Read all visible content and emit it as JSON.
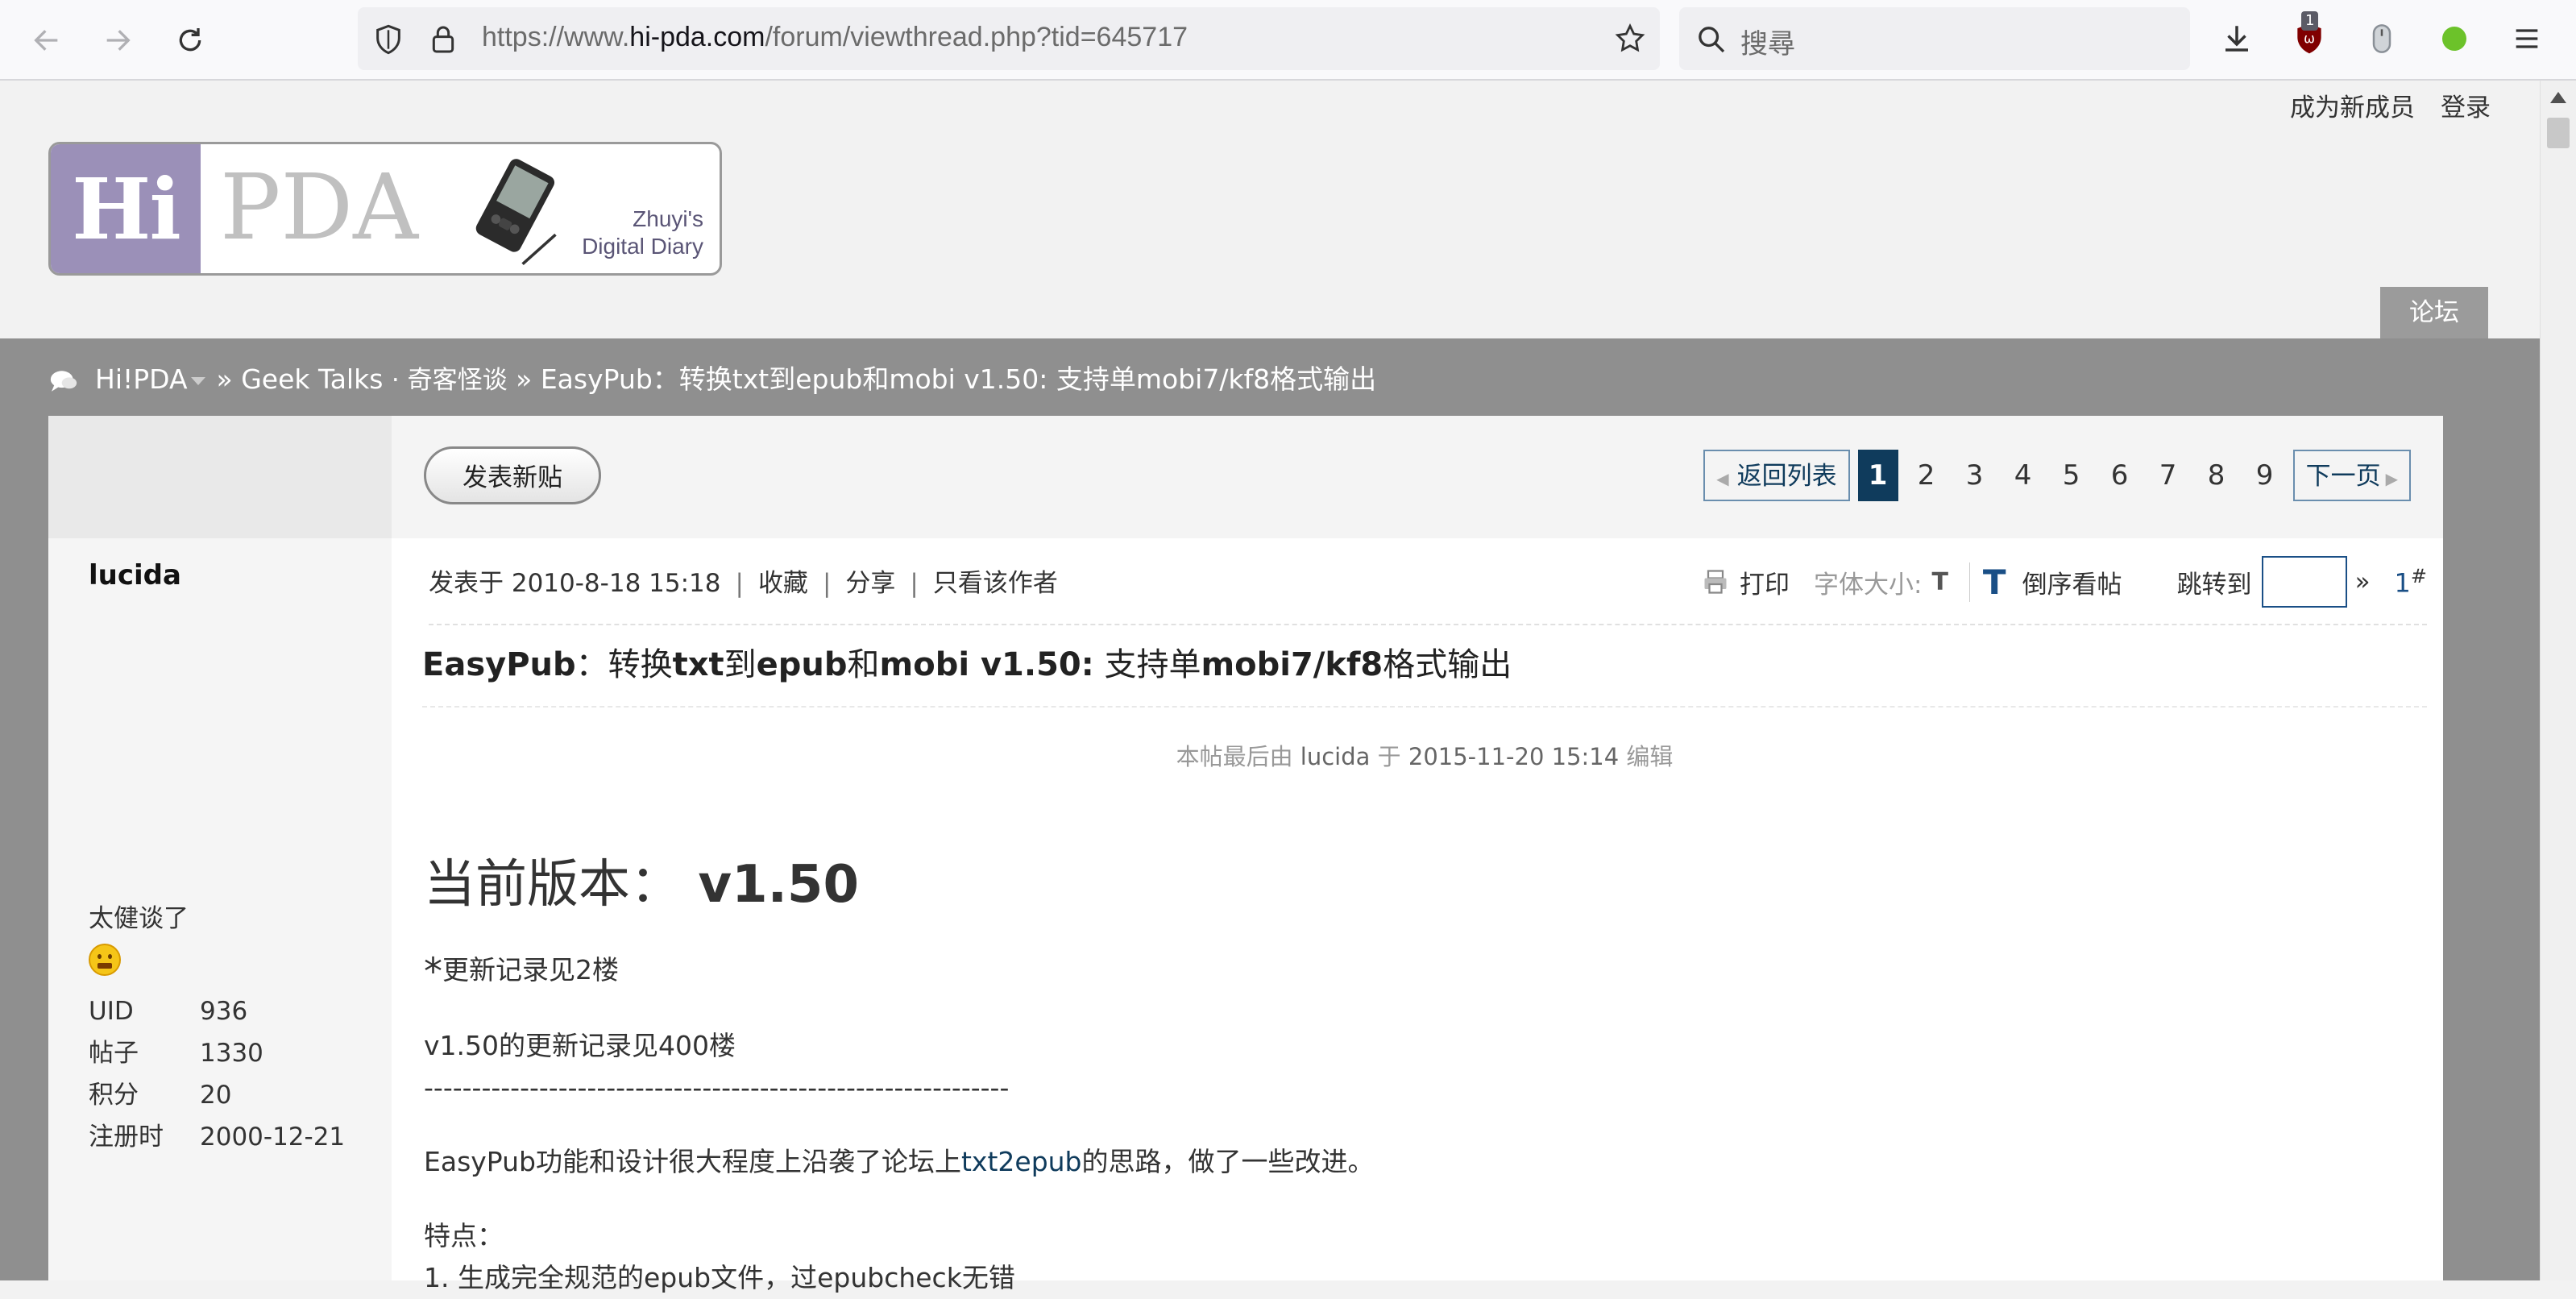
{
  "browser": {
    "url_prefix": "https://www.",
    "url_domain": "hi-pda.com",
    "url_path": "/forum/viewthread.php?tid=645717",
    "search_placeholder": "搜尋",
    "ublock_count": "1"
  },
  "top_links": [
    "成为新成员",
    "登录"
  ],
  "logo": {
    "hi": "Hi",
    "pda": "PDA",
    "tag_line1": "Zhuyi's",
    "tag_line2": "Digital Diary"
  },
  "forum_tab": "论坛",
  "breadcrumb": {
    "home": "Hi!PDA",
    "sep1": "»",
    "forum": "Geek Talks",
    "forum_sub": "· 奇客怪谈",
    "sep2": "»",
    "thread": "EasyPub：转换txt到epub和mobi v1.50: 支持单mobi7/kf8格式输出"
  },
  "toolbar": {
    "new_post": "发表新贴",
    "back_list": "返回列表",
    "pages": [
      "1",
      "2",
      "3",
      "4",
      "5",
      "6",
      "7",
      "8",
      "9"
    ],
    "current_page": "1",
    "next": "下一页"
  },
  "author": {
    "name": "lucida",
    "title": "太健谈了",
    "stats": [
      {
        "k": "UID",
        "v": "936"
      },
      {
        "k": "帖子",
        "v": "1330"
      },
      {
        "k": "积分",
        "v": "20"
      },
      {
        "k": "注册时",
        "v": "2000-12-21"
      }
    ]
  },
  "post_meta": {
    "posted_label": "发表于 2010-8-18 15:18",
    "fav": "收藏",
    "share": "分享",
    "only_author": "只看该作者",
    "print": "打印",
    "font_size": "字体大小:",
    "font_small": "T",
    "font_big": "T",
    "reverse": "倒序看帖",
    "jump": "跳转到",
    "jump_arrow": "»",
    "floor": "1",
    "floor_mark": "#"
  },
  "post": {
    "title_a": "EasyPub",
    "title_b": "：转换",
    "title_c": "txt",
    "title_d": "到",
    "title_e": "epub",
    "title_f": "和",
    "title_g": "mobi v1.50:",
    "title_h": " 支持单",
    "title_i": "mobi7/kf8",
    "title_j": "格式输出",
    "edit_pre": "本帖最后由",
    "edit_user": "lucida",
    "edit_mid": "于",
    "edit_time": "2015-11-20 15:14",
    "edit_post": "编辑",
    "heading_a": "当前版本：",
    "heading_b": "v1.50",
    "star": "*",
    "note1": "更新记录见2楼",
    "note2": "v1.50的更新记录见400楼",
    "dashes": "-------------------------------------------------------------",
    "intro_a": "EasyPub功能和设计很大程度上沿袭了论坛上",
    "intro_link": "txt2epub",
    "intro_b": "的思路，做了一些改进。",
    "features": "特点：",
    "feature1": "1. 生成完全规范的epub文件，过epubcheck无错"
  }
}
